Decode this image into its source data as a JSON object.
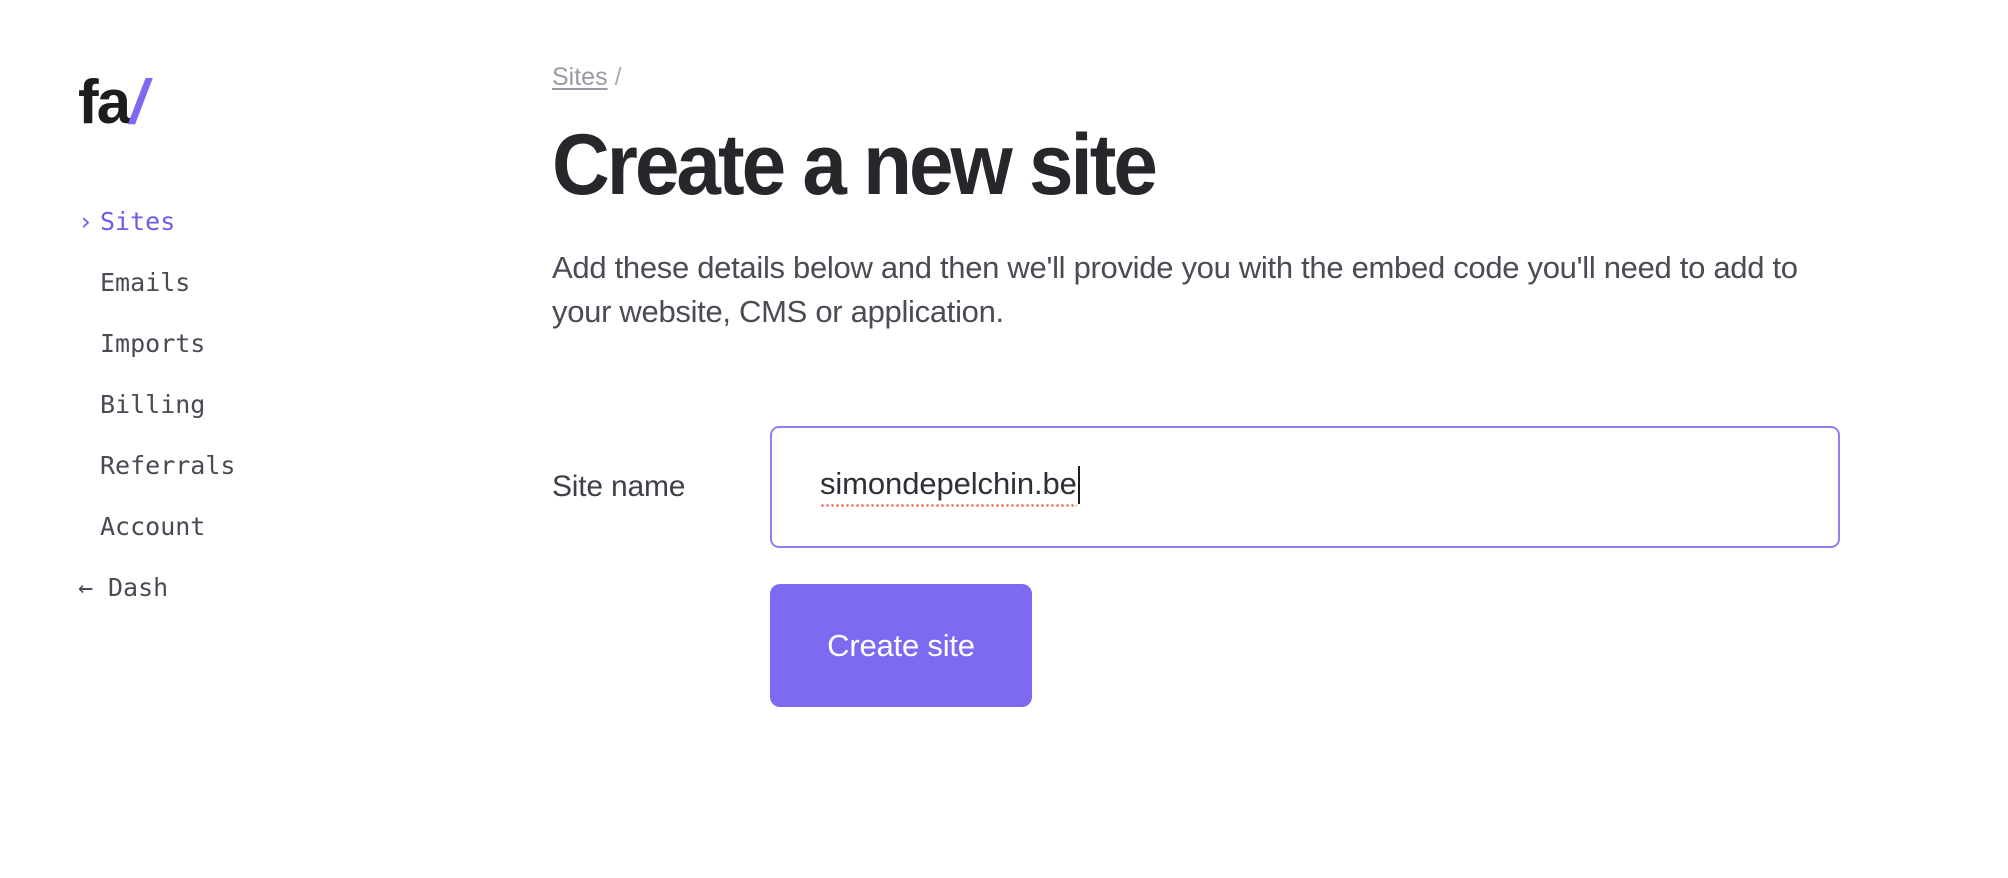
{
  "brand": {
    "logo_text": "fa",
    "logo_slash": "/"
  },
  "sidebar": {
    "items": [
      {
        "label": "Sites",
        "icon": "chevron-right-icon",
        "active": true
      },
      {
        "label": "Emails",
        "icon": "",
        "active": false
      },
      {
        "label": "Imports",
        "icon": "",
        "active": false
      },
      {
        "label": "Billing",
        "icon": "",
        "active": false
      },
      {
        "label": "Referrals",
        "icon": "",
        "active": false
      },
      {
        "label": "Account",
        "icon": "",
        "active": false
      },
      {
        "label": "Dash",
        "icon": "arrow-left-icon",
        "active": false
      }
    ],
    "chevron_glyph": "›",
    "arrow_glyph": "←"
  },
  "breadcrumb": {
    "link": "Sites",
    "separator": "/"
  },
  "main": {
    "title": "Create a new site",
    "description": "Add these details below and then we'll provide you with the embed code you'll need to add to your website, CMS or application."
  },
  "form": {
    "site_name_label": "Site name",
    "site_name_value": "simondepelchin.be",
    "site_name_placeholder": "",
    "submit_label": "Create site"
  },
  "colors": {
    "accent": "#7c6bf0",
    "accent_border": "#8f7ff0",
    "active_nav": "#6c5ce7",
    "title": "#26262b",
    "body_text": "#4b4b55",
    "muted": "#9a9aa4",
    "spellcheck_underline": "#ef6a5a"
  }
}
